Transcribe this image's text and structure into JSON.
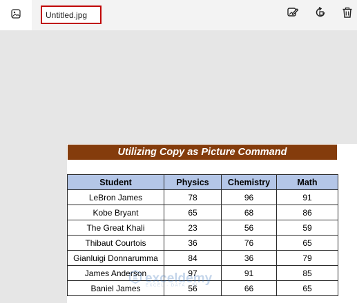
{
  "toolbar": {
    "file_name": "Untitled.jpg",
    "icons": [
      "image-icon",
      "edit-image-icon",
      "rotate-icon",
      "delete-icon"
    ]
  },
  "sheet": {
    "title": "Utilizing Copy as Picture Command",
    "headers": [
      "Student",
      "Physics",
      "Chemistry",
      "Math"
    ],
    "rows": [
      [
        "LeBron James",
        "78",
        "96",
        "91"
      ],
      [
        "Kobe Bryant",
        "65",
        "68",
        "86"
      ],
      [
        "The Great Khali",
        "23",
        "56",
        "59"
      ],
      [
        "Thibaut Courtois",
        "36",
        "76",
        "65"
      ],
      [
        "Gianluigi Donnarumma",
        "84",
        "36",
        "79"
      ],
      [
        "James Anderson",
        "97",
        "91",
        "85"
      ],
      [
        "Baniel James",
        "56",
        "66",
        "65"
      ]
    ]
  },
  "watermark": {
    "name": "exceldemy",
    "tagline": "EXCEL · DATA · BI"
  },
  "colors": {
    "title_bg": "#843c0c",
    "header_bg": "#b4c6e7",
    "filename_border": "#c00000",
    "canvas_bg": "#e6e6e6"
  }
}
